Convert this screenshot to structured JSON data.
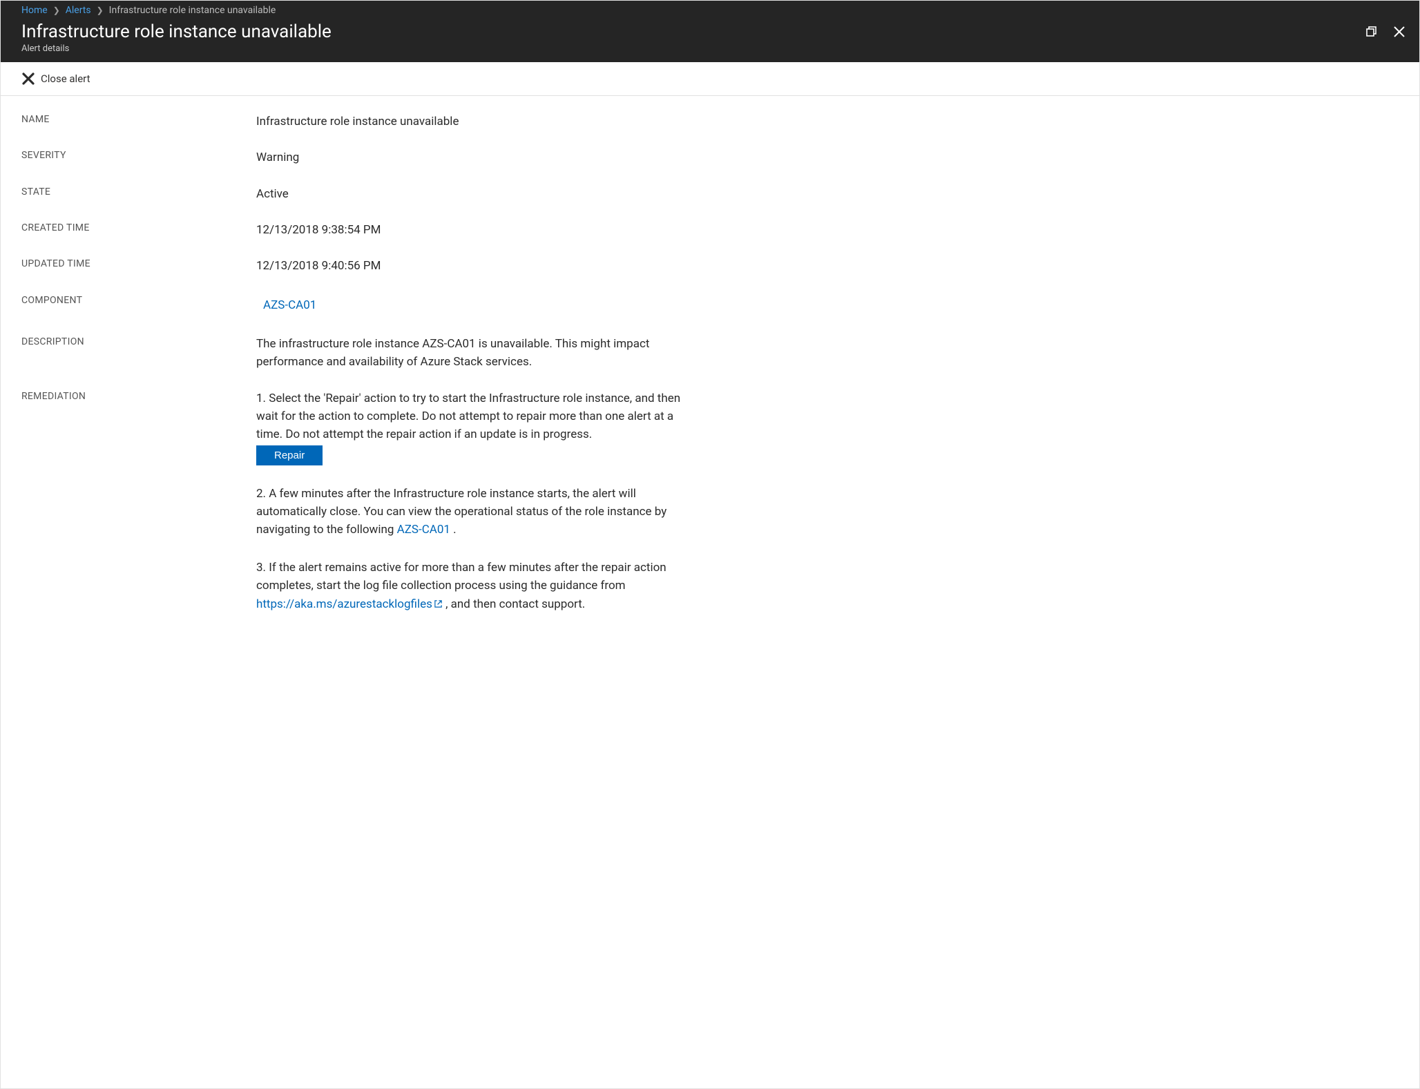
{
  "breadcrumb": {
    "home": "Home",
    "alerts": "Alerts",
    "current": "Infrastructure role instance unavailable"
  },
  "header": {
    "title": "Infrastructure role instance unavailable",
    "subtitle": "Alert details"
  },
  "toolbar": {
    "close_alert": "Close alert"
  },
  "labels": {
    "name": "NAME",
    "severity": "SEVERITY",
    "state": "STATE",
    "created_time": "CREATED TIME",
    "updated_time": "UPDATED TIME",
    "component": "COMPONENT",
    "description": "DESCRIPTION",
    "remediation": "REMEDIATION"
  },
  "values": {
    "name": "Infrastructure role instance unavailable",
    "severity": "Warning",
    "state": "Active",
    "created_time": "12/13/2018 9:38:54 PM",
    "updated_time": "12/13/2018 9:40:56 PM",
    "component": "AZS-CA01",
    "description": "The infrastructure role instance AZS-CA01 is unavailable. This might impact performance and availability of Azure Stack services."
  },
  "remediation": {
    "step1": "1. Select the 'Repair' action to try to start the Infrastructure role instance, and then wait for the action to complete. Do not attempt to repair more than one alert at a time. Do not attempt the repair action if an update is in progress.",
    "repair_button": "Repair",
    "step2_pre": "2. A few minutes after the Infrastructure role instance starts, the alert will automatically close. You can view the operational status of the role instance by navigating to the following ",
    "step2_link": "AZS-CA01",
    "step2_post": " .",
    "step3_pre": "3. If the alert remains active for more than a few minutes after the repair action completes, start the log file collection process using the guidance from ",
    "step3_link": "https://aka.ms/azurestacklogfiles",
    "step3_post": " , and then contact support."
  }
}
